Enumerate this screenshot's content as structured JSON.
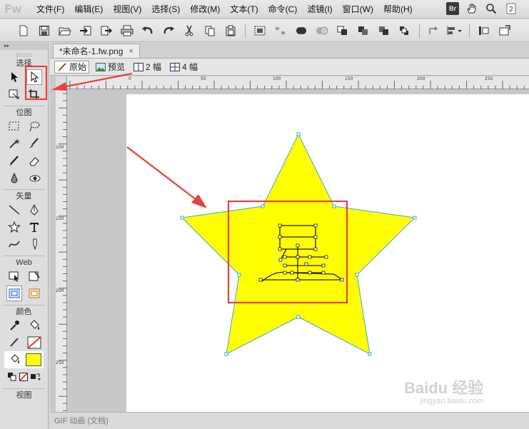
{
  "app": {
    "logo": "Fw",
    "menu": [
      "文件(F)",
      "编辑(E)",
      "视图(V)",
      "选择(S)",
      "修改(M)",
      "文本(T)",
      "命令(C)",
      "滤镜(I)",
      "窗口(W)",
      "帮助(H)"
    ],
    "bridge_badge": "Br"
  },
  "toolbar": {
    "buttons": [
      "new-icon",
      "save-icon",
      "open-icon",
      "import-icon",
      "export-icon",
      "print-icon",
      "undo-icon",
      "redo-icon",
      "cut-icon",
      "copy-icon",
      "paste-icon",
      "group-icon",
      "ungroup-icon",
      "join-icon",
      "split-icon",
      "bring-front-icon",
      "bring-forward-icon",
      "send-backward-icon",
      "send-back-icon",
      "rotate-icon",
      "align-icon",
      "distribute-icon",
      "flip-icon"
    ]
  },
  "tools": {
    "collapse_glyph": "▸▸",
    "sections": {
      "select": "选择",
      "bitmap": "位图",
      "vector": "矢量",
      "web": "Web",
      "colors": "颜色",
      "view": "视图"
    },
    "colors": {
      "stroke": "#ff0000",
      "fill": "#ffff00"
    }
  },
  "document": {
    "tab_title": "*未命名-1.fw.png",
    "tab_close": "×",
    "views": [
      "原始",
      "预览",
      "2 幅",
      "4 幅"
    ],
    "status": "GIF 动画 (文档)",
    "ruler_h": [
      "0",
      "50",
      "100",
      "150",
      "200",
      "250"
    ],
    "ruler_v": [
      "100",
      "150",
      "200",
      "250"
    ],
    "star": {
      "fill": "#ffff00",
      "stroke": "#3fa9d5"
    }
  },
  "annotation": {
    "color": "#e84040"
  },
  "watermark": {
    "main": "Baidu 经验",
    "sub": "jingyan.baidu.com"
  }
}
